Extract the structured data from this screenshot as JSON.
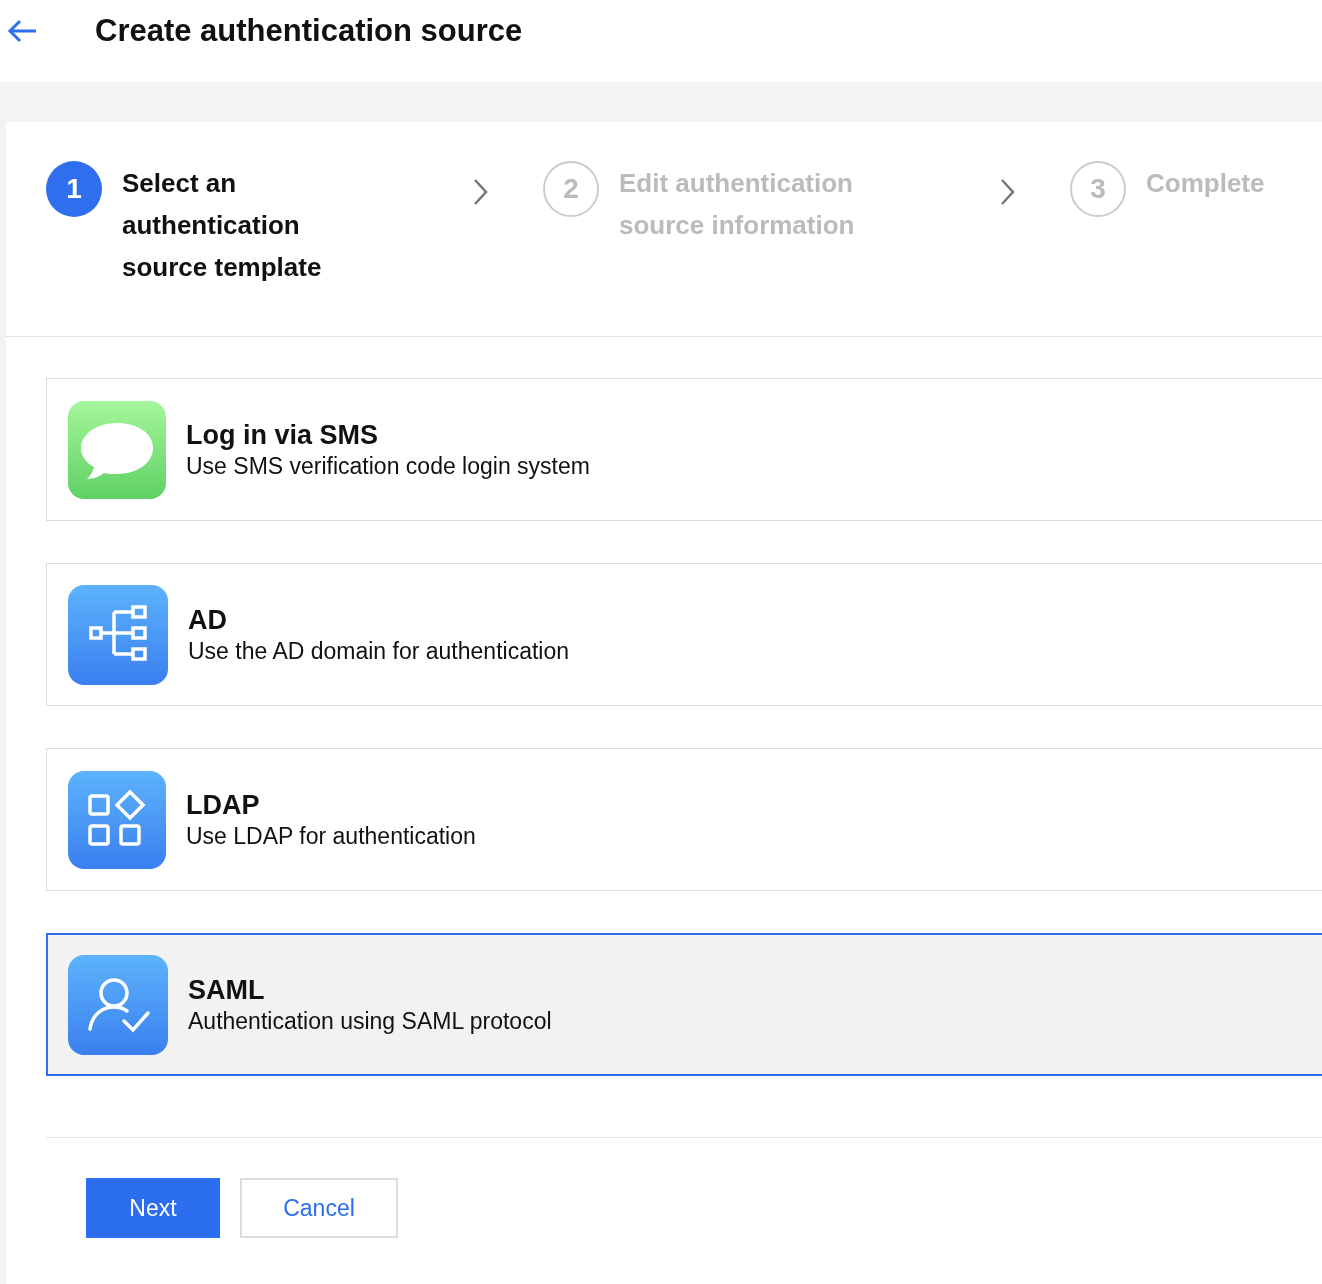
{
  "header": {
    "title": "Create authentication source"
  },
  "steps": [
    {
      "number": "1",
      "label": "Select an authentication source template",
      "active": true
    },
    {
      "number": "2",
      "label": "Edit authentication source information",
      "active": false
    },
    {
      "number": "3",
      "label": "Complete",
      "active": false
    }
  ],
  "options": [
    {
      "kind": "sms",
      "title": "Log in via SMS",
      "description": "Use SMS verification code login system",
      "selected": false
    },
    {
      "kind": "ad",
      "title": "AD",
      "description": "Use the AD domain for authentication",
      "selected": false
    },
    {
      "kind": "ldap",
      "title": "LDAP",
      "description": "Use LDAP for authentication",
      "selected": false
    },
    {
      "kind": "saml",
      "title": "SAML",
      "description": "Authentication using SAML protocol",
      "selected": true
    }
  ],
  "buttons": [
    {
      "kind": "primary",
      "label": "Next"
    },
    {
      "kind": "secondary",
      "label": "Cancel"
    }
  ]
}
